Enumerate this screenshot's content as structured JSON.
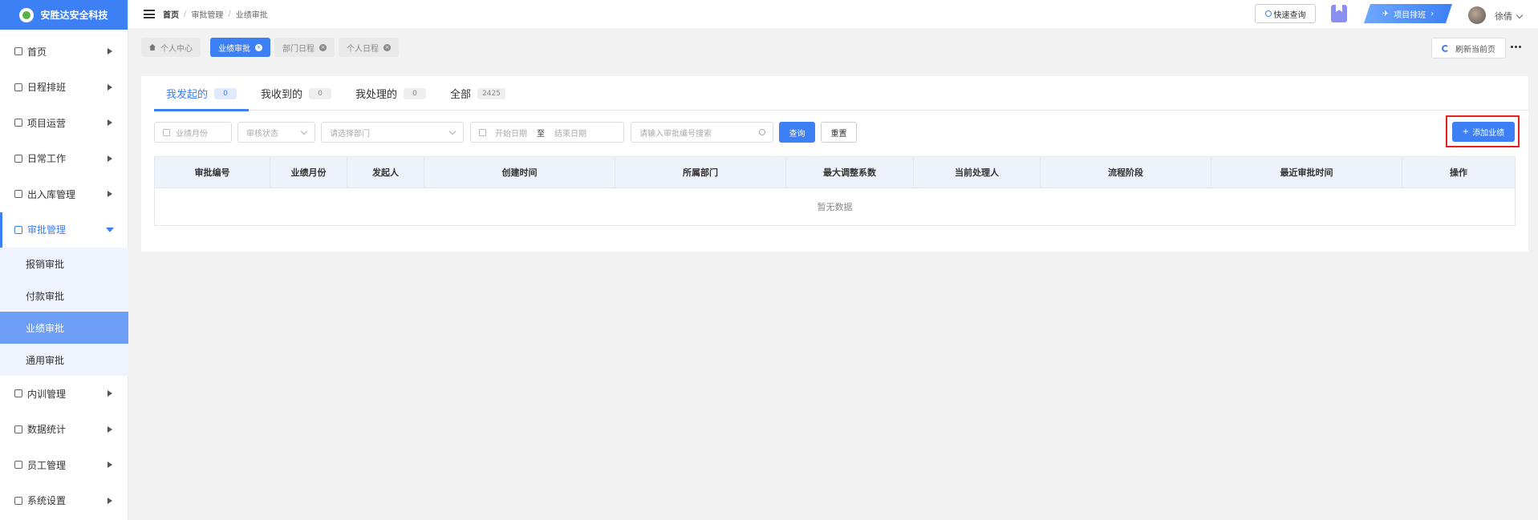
{
  "app": {
    "title": "安胜达安全科技"
  },
  "sidebar": {
    "items": [
      {
        "label": "首页"
      },
      {
        "label": "日程排班"
      },
      {
        "label": "项目运营"
      },
      {
        "label": "日常工作"
      },
      {
        "label": "出入库管理"
      },
      {
        "label": "审批管理"
      },
      {
        "label": "内训管理"
      },
      {
        "label": "数据统计"
      },
      {
        "label": "员工管理"
      },
      {
        "label": "系统设置"
      }
    ],
    "submenu": [
      {
        "label": "报销审批"
      },
      {
        "label": "付款审批"
      },
      {
        "label": "业绩审批"
      },
      {
        "label": "通用审批"
      }
    ]
  },
  "header": {
    "breadcrumb": [
      "首页",
      "审批管理",
      "业绩审批"
    ],
    "quick_search": "快速查询",
    "project_btn": "项目排班",
    "username": "徐倩"
  },
  "tags": [
    {
      "label": "个人中心"
    },
    {
      "label": "业绩审批"
    },
    {
      "label": "部门日程"
    },
    {
      "label": "个人日程"
    }
  ],
  "refresh_label": "刷新当前页",
  "tabs": [
    {
      "label": "我发起的",
      "count": "0"
    },
    {
      "label": "我收到的",
      "count": "0"
    },
    {
      "label": "我处理的",
      "count": "0"
    },
    {
      "label": "全部",
      "count": "2425"
    }
  ],
  "filters": {
    "month_placeholder": "业绩月份",
    "status_placeholder": "审核状态",
    "dept_placeholder": "请选择部门",
    "start_placeholder": "开始日期",
    "range_sep": "至",
    "end_placeholder": "结束日期",
    "search_placeholder": "请输入审批编号搜索",
    "query_label": "查询",
    "reset_label": "重置",
    "add_label": "添加业绩"
  },
  "table": {
    "columns": [
      "审批编号",
      "业绩月份",
      "发起人",
      "创建时间",
      "所属部门",
      "最大调整系数",
      "当前处理人",
      "流程阶段",
      "最近审批时间",
      "操作"
    ],
    "empty_text": "暂无数据"
  }
}
